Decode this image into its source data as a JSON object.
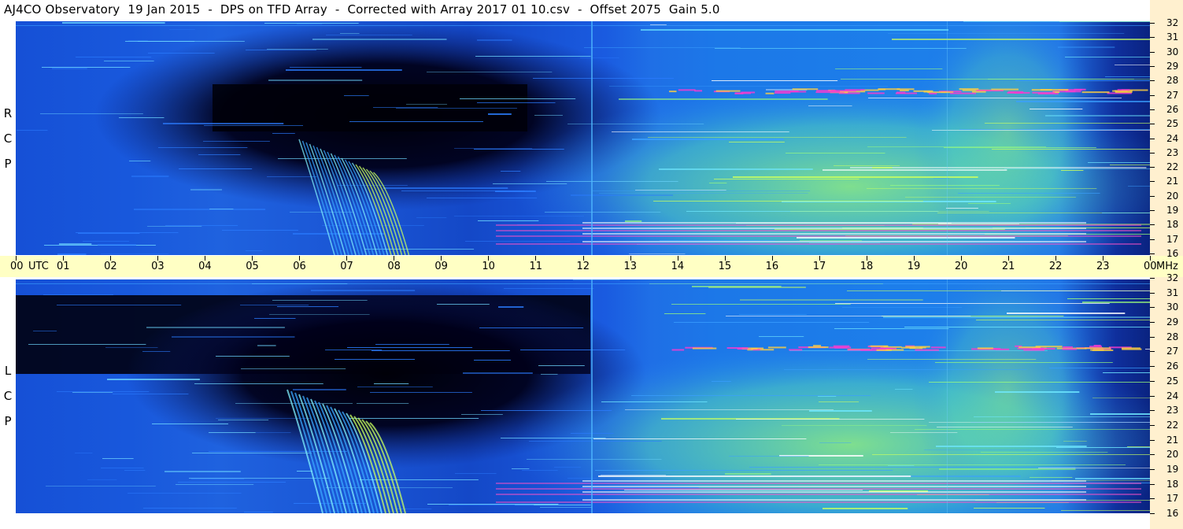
{
  "chart_data": [
    {
      "type": "heatmap",
      "title": "AJ4CO Observatory  19 Jan 2015  -  DPS on TFD Array  -  Corrected with Array 2017 01 10.csv  -  Offset 2075  Gain 5.0",
      "panel_label": [
        "R",
        "C",
        "P"
      ],
      "x_ticks": [
        "00",
        "01",
        "02",
        "03",
        "04",
        "05",
        "06",
        "07",
        "08",
        "09",
        "10",
        "11",
        "12",
        "13",
        "14",
        "15",
        "16",
        "17",
        "18",
        "19",
        "20",
        "21",
        "22",
        "23",
        "00"
      ],
      "x_range": [
        0,
        24
      ],
      "y_ticks": [
        16,
        17,
        18,
        19,
        20,
        21,
        22,
        23,
        24,
        25,
        26,
        27,
        28,
        29,
        30,
        31,
        32
      ],
      "y_range": [
        16,
        32
      ],
      "colors": {
        "low": "#000010",
        "mid": "#1a5ee0",
        "high": "#9eff60",
        "peak": "#ff3ad0"
      }
    },
    {
      "type": "heatmap",
      "panel_label": [
        "L",
        "C",
        "P"
      ],
      "x_ticks": [
        "00",
        "01",
        "02",
        "03",
        "04",
        "05",
        "06",
        "07",
        "08",
        "09",
        "10",
        "11",
        "12",
        "13",
        "14",
        "15",
        "16",
        "17",
        "18",
        "19",
        "20",
        "21",
        "22",
        "23",
        "00"
      ],
      "x_range": [
        0,
        24
      ],
      "y_ticks": [
        16,
        17,
        18,
        19,
        20,
        21,
        22,
        23,
        24,
        25,
        26,
        27,
        28,
        29,
        30,
        31,
        32
      ],
      "y_range": [
        16,
        32
      ],
      "colors": {
        "low": "#000010",
        "mid": "#1a5ee0",
        "high": "#9eff60",
        "peak": "#ff3ad0"
      }
    }
  ],
  "x_axis": {
    "utc_label": "UTC",
    "unit_label": "MHz"
  }
}
